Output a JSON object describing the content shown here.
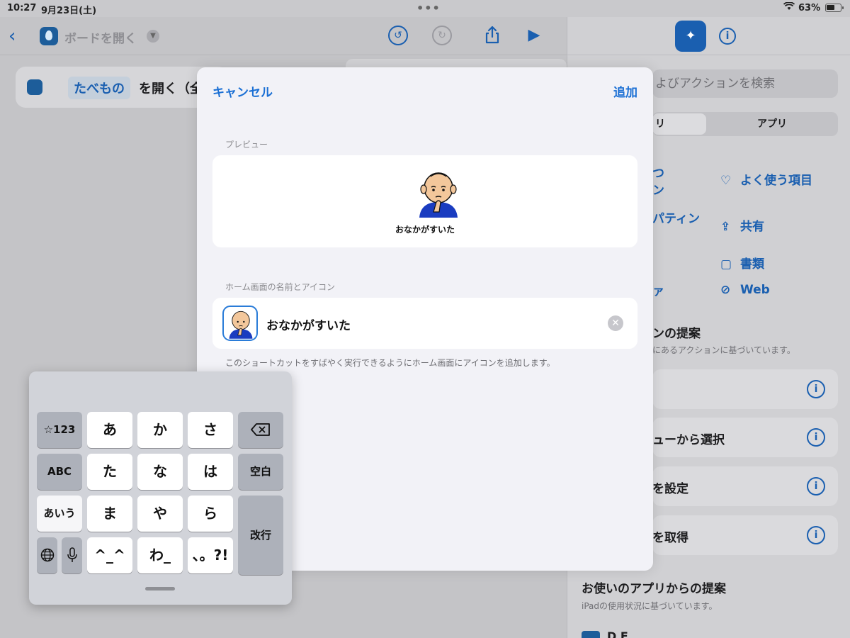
{
  "status": {
    "time": "10:27",
    "date": "9月23日(土)",
    "dots": "•••",
    "battery": "63%",
    "wifi_icon": "wifi-icon",
    "battery_level": 0.63
  },
  "editor": {
    "back_glyph": "‹",
    "board_title": "ボードを開く",
    "undo_glyph": "↺",
    "redo_glyph": "↻",
    "share_glyph": "⇪",
    "play_glyph": "▶",
    "action": {
      "token": "たべもの",
      "text": "を開く（全画"
    }
  },
  "sheet": {
    "cancel": "キャンセル",
    "add": "追加",
    "preview_label": "プレビュー",
    "preview_caption": "おなかがすいた",
    "name_icon_label": "ホーム画面の名前とアイコン",
    "name_value": "おなかがすいた",
    "clear_glyph": "✕",
    "hint": "このショートカットをすばやく実行できるようにホーム画面にアイコンを追加します。"
  },
  "right_panel": {
    "search_placeholder": "よびアクションを検索",
    "segment": [
      "リ",
      "アプリ"
    ],
    "categories_left": [
      "つ",
      "ン",
      "パティン",
      "ァ"
    ],
    "categories": [
      {
        "icon": "heart-icon",
        "glyph": "♡",
        "label": "よく使う項目"
      },
      {
        "icon": "share-icon",
        "glyph": "⇪",
        "label": "共有"
      },
      {
        "icon": "document-icon",
        "glyph": "▢",
        "label": "書類"
      },
      {
        "icon": "compass-icon",
        "glyph": "⊘",
        "label": "Web"
      }
    ],
    "suggest_title": "ンの提案",
    "suggest_sub": "にあるアクションに基づいています。",
    "rows": [
      "",
      "ューから選択",
      "を設定",
      "を取得"
    ],
    "info_glyph": "i",
    "apps_title": "お使いのアプリからの提案",
    "apps_sub": "iPadの使用状況に基づいています。",
    "bottom_app": "D  E"
  },
  "keyboard": {
    "rows": [
      [
        "☆123",
        "あ",
        "か",
        "さ",
        "⌫"
      ],
      [
        "ABC",
        "た",
        "な",
        "は",
        "空白"
      ],
      [
        "あいう",
        "ま",
        "や",
        "ら",
        "改行"
      ],
      [
        "🌐",
        "🎤",
        "^_^",
        "わ_",
        "、。?!"
      ]
    ]
  },
  "colors": {
    "accent": "#1a6fd4",
    "dim_accent": "#1a5fb0",
    "sheet_bg": "#f2f2f7"
  }
}
